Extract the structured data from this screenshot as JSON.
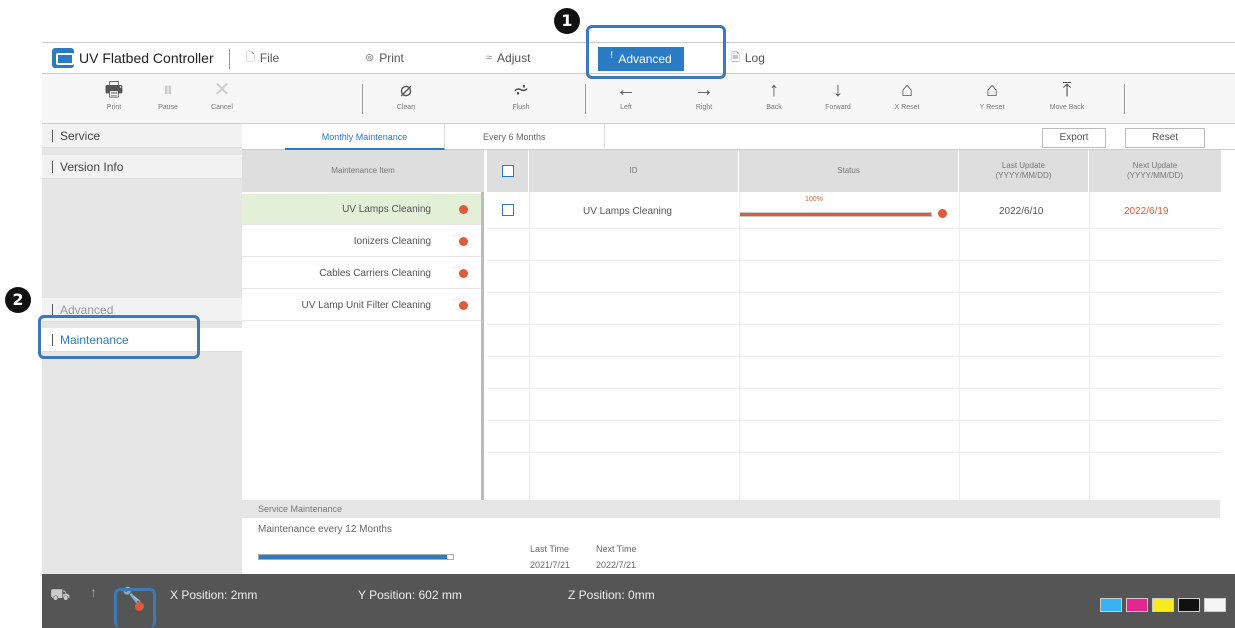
{
  "menubar": {
    "app_title": "UV Flatbed Controller",
    "items": [
      {
        "label": "File",
        "icon": "file-icon"
      },
      {
        "label": "Print",
        "icon": "print-icon"
      },
      {
        "label": "Adjust",
        "icon": "adjust-icon"
      },
      {
        "label": "Advanced",
        "icon": "wrench-icon",
        "active": true
      },
      {
        "label": "Log",
        "icon": "log-icon"
      }
    ]
  },
  "toolbar": {
    "buttons": [
      {
        "label": "Print",
        "icon": "printer-icon"
      },
      {
        "label": "Pause",
        "icon": "pause-icon"
      },
      {
        "label": "Cancel",
        "icon": "cancel-icon"
      },
      {
        "label": "Clean",
        "icon": "clean-icon"
      },
      {
        "label": "Flush",
        "icon": "flush-icon"
      },
      {
        "label": "Left",
        "icon": "arrow-left-icon"
      },
      {
        "label": "Right",
        "icon": "arrow-right-icon"
      },
      {
        "label": "Back",
        "icon": "arrow-up-icon"
      },
      {
        "label": "Forward",
        "icon": "arrow-down-icon"
      },
      {
        "label": "X Reset",
        "icon": "x-reset-icon"
      },
      {
        "label": "Y Reset",
        "icon": "y-reset-icon"
      },
      {
        "label": "Move Back",
        "icon": "move-back-icon"
      }
    ]
  },
  "sidebar": {
    "items": [
      {
        "label": "Service"
      },
      {
        "label": "Version Info"
      },
      {
        "label": "Advanced"
      },
      {
        "label": "Maintenance"
      }
    ]
  },
  "tabs": {
    "monthly": "Monthly Maintenance",
    "six_months": "Every 6 Months",
    "export": "Export",
    "reset": "Reset"
  },
  "left_list": {
    "header": "Maintenance Item",
    "items": [
      "UV Lamps Cleaning",
      "Ionizers Cleaning",
      "Cables Carriers Cleaning",
      "UV Lamp Unit Filter Cleaning"
    ]
  },
  "grid": {
    "headers": {
      "id": "ID",
      "status": "Status",
      "last_update": "Last Update (YYYY/MM/DD)",
      "next_update": "Next Update (YYYY/MM/DD)"
    },
    "rows": [
      {
        "id": "UV Lamps Cleaning",
        "status_value": "100%",
        "progress": 1.0,
        "last_update": "2022/6/10",
        "next_update": "2022/6/19"
      }
    ]
  },
  "service": {
    "header": "Service Maintenance",
    "label": "Maintenance every 12 Months",
    "progress": 0.97,
    "last_time_label": "Last Time",
    "last_time": "2021/7/21",
    "next_time_label": "Next Time",
    "next_time": "2022/7/21"
  },
  "statusbar": {
    "x_position": "X Position: 2mm",
    "y_position": "Y Position: 602 mm",
    "z_position": "Z Position: 0mm"
  },
  "callouts": {
    "one": "1",
    "two": "2"
  },
  "colors": {
    "accent": "#2a7ac4",
    "warning": "#e05a3a",
    "progress_status": "#e05a3a",
    "selected_row": "#e3efd7"
  }
}
